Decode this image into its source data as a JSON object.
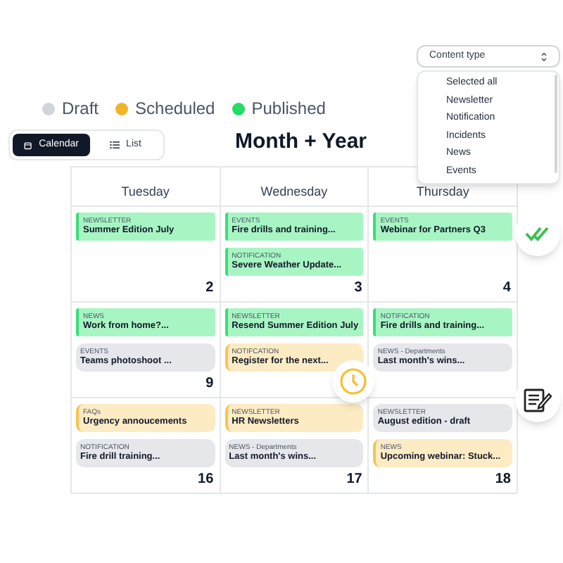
{
  "legend": [
    {
      "label": "Draft",
      "color": "#d1d5db"
    },
    {
      "label": "Scheduled",
      "color": "#f0b429"
    },
    {
      "label": "Published",
      "color": "#22dd66"
    }
  ],
  "view_toggle": [
    {
      "label": "Calendar",
      "selected": true
    },
    {
      "label": "List",
      "selected": false
    }
  ],
  "title": "Month + Year",
  "content_type": {
    "label": "Content type",
    "options": [
      "Selected all",
      "Newsletter",
      "Notification",
      "Incidents",
      "News",
      "Events"
    ]
  },
  "calendar": {
    "days": [
      "Tuesday",
      "Wednesday",
      "Thursday"
    ],
    "weeks": [
      [
        {
          "date": "2",
          "events": [
            {
              "category": "NEWSLETTER",
              "title": "Summer Edition July",
              "kind": "published"
            }
          ]
        },
        {
          "date": "3",
          "events": [
            {
              "category": "EVENTS",
              "title": "Fire drills and training...",
              "kind": "published"
            },
            {
              "category": "NOTIFICATION",
              "title": "Severe Weather Update...",
              "kind": "published"
            }
          ]
        },
        {
          "date": "4",
          "events": [
            {
              "category": "EVENTS",
              "title": "Webinar for Partners Q3",
              "kind": "published"
            }
          ]
        }
      ],
      [
        {
          "date": "9",
          "events": [
            {
              "category": "NEWS",
              "title": "Work from home?...",
              "kind": "published"
            },
            {
              "category": "EVENTS",
              "title": "Teams photoshoot ...",
              "kind": "draft"
            }
          ]
        },
        {
          "events": [
            {
              "category": "NEWSLETTER",
              "title": "Resend Summer Edition July",
              "kind": "published"
            },
            {
              "category": "NOTIFCATION",
              "title": "Register for the next...",
              "kind": "scheduled"
            }
          ]
        },
        {
          "events": [
            {
              "category": "NOTIFICATION",
              "title": "Fire drills and training...",
              "kind": "published"
            },
            {
              "category": "NEWS - Departments",
              "title": "Last month's wins...",
              "kind": "draft"
            }
          ]
        }
      ],
      [
        {
          "date": "16",
          "events": [
            {
              "category": "FAQs",
              "title": "Urgency annoucements",
              "kind": "scheduled"
            },
            {
              "category": "NOTIFICATION",
              "title": "Fire drill training...",
              "kind": "draft"
            }
          ]
        },
        {
          "date": "17",
          "events": [
            {
              "category": "NEWSLETTER",
              "title": "HR Newsletters",
              "kind": "scheduled"
            },
            {
              "category": "NEWS - Departments",
              "title": "Last month's wins...",
              "kind": "draft"
            }
          ]
        },
        {
          "date": "18",
          "events": [
            {
              "category": "NEWSLETTER",
              "title": "August edition - draft",
              "kind": "draft"
            },
            {
              "category": "NEWS",
              "title": "Upcoming webinar: Stuck...",
              "kind": "scheduled"
            }
          ]
        }
      ]
    ]
  }
}
